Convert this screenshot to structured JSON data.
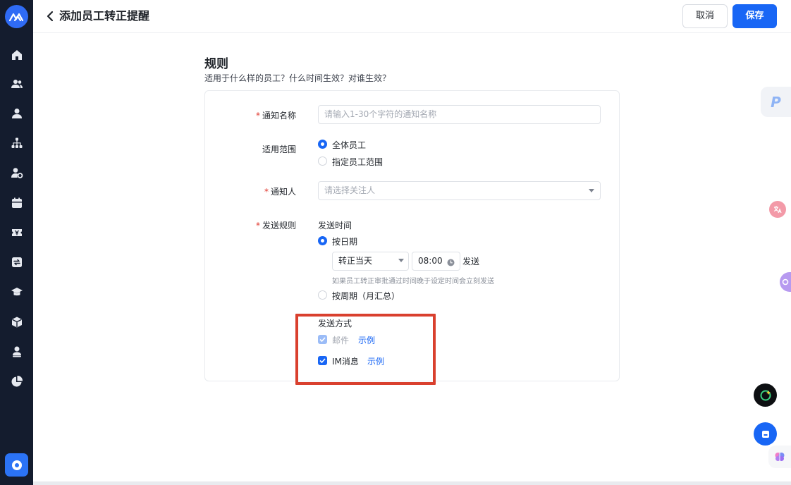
{
  "header": {
    "title": "添加员工转正提醒",
    "cancel_label": "取消",
    "save_label": "保存"
  },
  "section": {
    "title": "规则",
    "description": "适用于什么样的员工？什么时间生效？对谁生效？"
  },
  "form": {
    "notice_name": {
      "label": "通知名称",
      "placeholder": "请输入1-30个字符的通知名称"
    },
    "scope": {
      "label": "适用范围",
      "options": [
        "全体员工",
        "指定员工范围"
      ],
      "selected": "全体员工"
    },
    "notifier": {
      "label": "通知人",
      "placeholder": "请选择关注人"
    },
    "send_rule": {
      "label": "发送规则",
      "time_title": "发送时间",
      "by_date_label": "按日期",
      "date_select_value": "转正当天",
      "time_value": "08:00",
      "send_suffix": "发送",
      "hint": "如果员工转正审批通过时间晚于设定时间会立刻发送",
      "by_period_label": "按周期（月汇总）",
      "method_title": "发送方式",
      "email_label": "邮件",
      "email_example": "示例",
      "im_label": "IM消息",
      "im_example": "示例"
    }
  },
  "colors": {
    "sidebar_bg": "#141c2e",
    "primary": "#1866f5",
    "required": "#e0392f",
    "highlight_border": "#d9402e"
  },
  "icons": [
    "home-icon",
    "users-icon",
    "user-icon",
    "org-chart-icon",
    "user-settings-icon",
    "calendar-icon",
    "ticket-icon",
    "swap-icon",
    "graduation-icon",
    "box-icon",
    "person-icon",
    "pie-chart-icon",
    "settings-icon"
  ]
}
